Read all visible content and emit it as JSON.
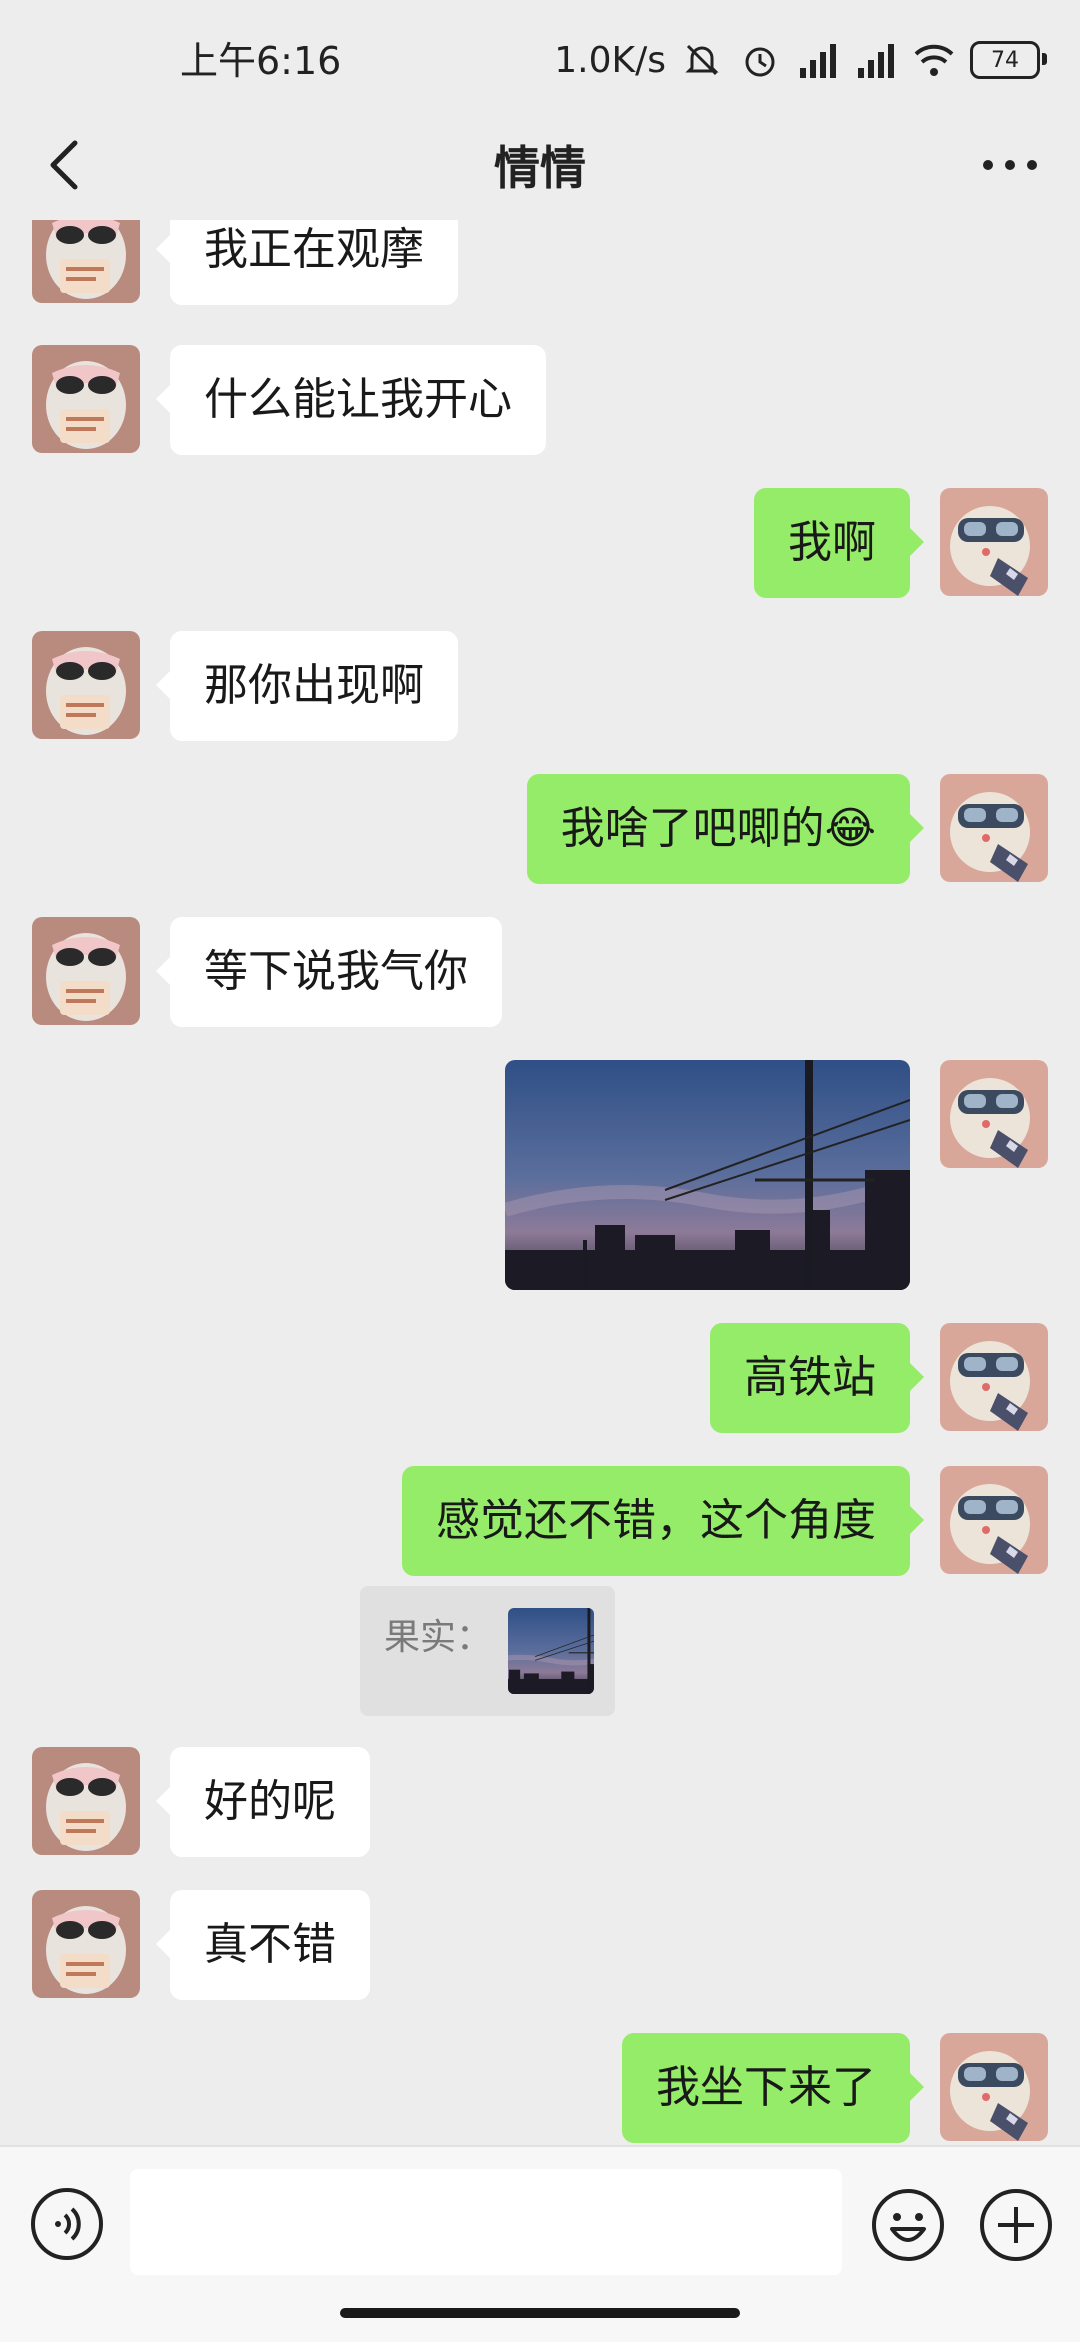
{
  "status_bar": {
    "time": "上午6:16",
    "net_speed": "1.0K/s",
    "battery": "74"
  },
  "header": {
    "title": "情情"
  },
  "messages": [
    {
      "side": "in",
      "text": "我正在观摩"
    },
    {
      "side": "in",
      "text": "什么能让我开心"
    },
    {
      "side": "out",
      "text": "我啊"
    },
    {
      "side": "in",
      "text": "那你出现啊"
    },
    {
      "side": "out",
      "text": "我啥了吧唧的😂"
    },
    {
      "side": "in",
      "text": "等下说我气你"
    },
    {
      "side": "out",
      "type": "image"
    },
    {
      "side": "out",
      "text": "高铁站"
    },
    {
      "side": "out",
      "text": "感觉还不错，这个角度",
      "quote_label": "果实："
    },
    {
      "side": "in",
      "text": "好的呢"
    },
    {
      "side": "in",
      "text": "真不错"
    },
    {
      "side": "out",
      "text": "我坐下来了"
    }
  ],
  "input": {
    "placeholder": ""
  },
  "colors": {
    "background": "#ededed",
    "incoming_bubble": "#ffffff",
    "outgoing_bubble": "#95ec69"
  },
  "icons": [
    "back-arrow-icon",
    "more-dots-icon",
    "voice-icon",
    "emoji-icon",
    "plus-icon",
    "mute-icon",
    "alarm-icon",
    "signal-icon",
    "wifi-icon",
    "battery-icon"
  ]
}
